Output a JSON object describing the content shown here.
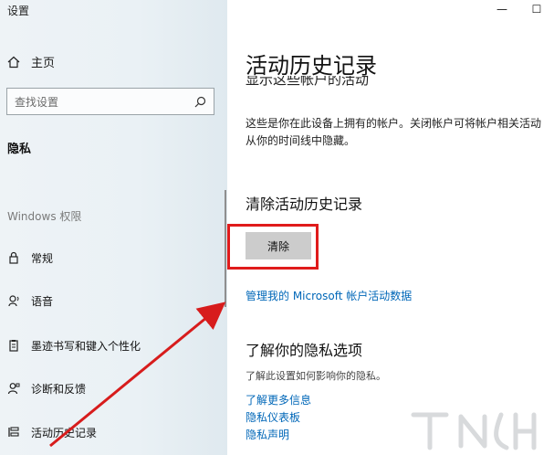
{
  "window": {
    "title": "设置",
    "minimize_glyph": "—",
    "maximize_glyph": "☐"
  },
  "sidebar": {
    "home_label": "主页",
    "search_placeholder": "查找设置",
    "section_title": "隐私",
    "group_label": "Windows 权限",
    "items": [
      {
        "label": "常规",
        "icon": "lock-icon"
      },
      {
        "label": "语音",
        "icon": "speech-icon"
      },
      {
        "label": "墨迹书写和键入个性化",
        "icon": "clipboard-icon"
      },
      {
        "label": "诊断和反馈",
        "icon": "feedback-icon"
      },
      {
        "label": "活动历史记录",
        "icon": "timeline-icon"
      }
    ]
  },
  "main": {
    "page_title": "活动历史记录",
    "clipped_heading": "显示这些帐户的活动",
    "description": "这些是你在此设备上拥有的帐户。关闭帐户可将帐户相关活动从你的时间线中隐藏。",
    "clear_heading": "清除活动历史记录",
    "clear_button": "清除",
    "manage_link": "管理我的 Microsoft 帐户活动数据",
    "privacy_heading": "了解你的隐私选项",
    "privacy_desc": "了解此设置如何影响你的隐私。",
    "links": [
      "了解更多信息",
      "隐私仪表板",
      "隐私声明"
    ]
  },
  "colors": {
    "accent_link": "#0067b8",
    "highlight_red": "#e01b1b",
    "button_bg": "#cccccc"
  }
}
